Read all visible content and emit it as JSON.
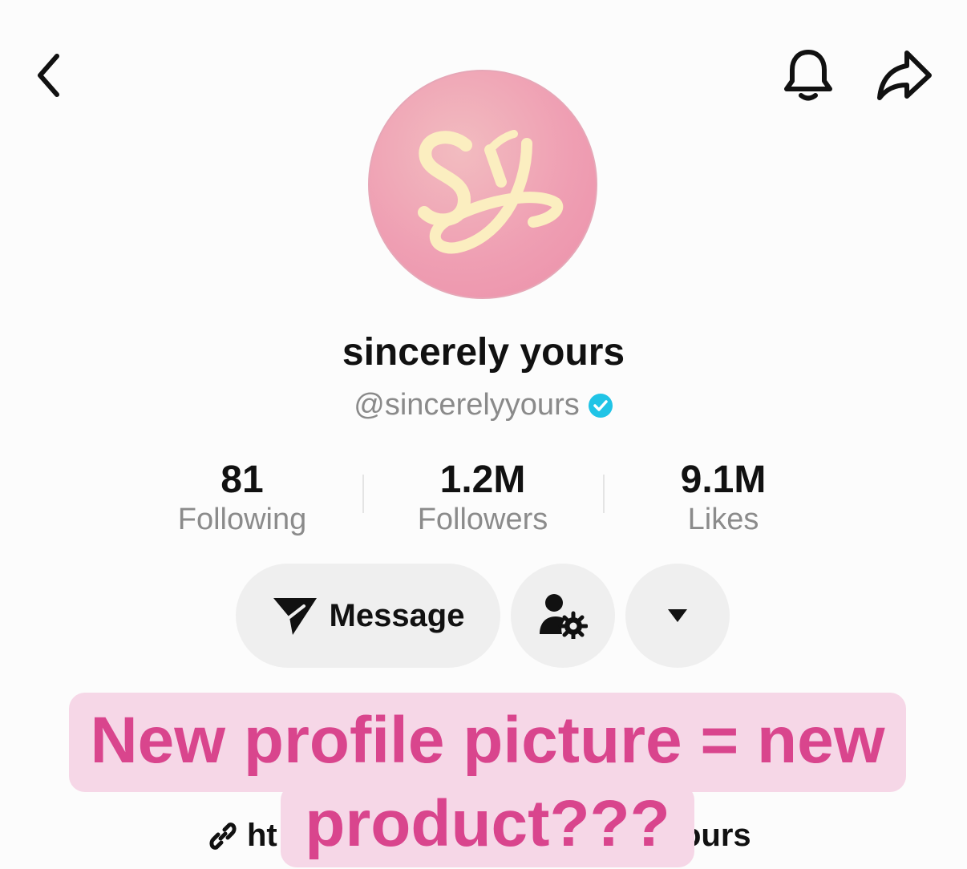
{
  "profile": {
    "display_name": "sincerely yours",
    "handle": "@sincerelyyours",
    "verified": true,
    "avatar_monogram": "SY",
    "avatar_colors": [
      "#f2bcc0",
      "#eb8fa9",
      "#fbeec0"
    ]
  },
  "header": {
    "back_icon": "chevron-left-icon",
    "bell_icon": "bell-icon",
    "share_icon": "share-arrow-icon"
  },
  "stats": [
    {
      "value": "81",
      "label": "Following"
    },
    {
      "value": "1.2M",
      "label": "Followers"
    },
    {
      "value": "9.1M",
      "label": "Likes"
    }
  ],
  "actions": {
    "message_label": "Message",
    "message_icon": "send-icon",
    "friend_settings_icon": "user-gear-icon",
    "more_icon": "caret-down-icon"
  },
  "bio": {
    "link_start": "ht",
    "link_end": "ours",
    "link_icon": "link-icon"
  },
  "overlay": {
    "caption_line1": "New profile picture = new",
    "caption_line2": "product???",
    "color": "#d9458d",
    "background": "#f6d7e7"
  },
  "colors": {
    "verified": "#20c4e6",
    "text": "#111111",
    "muted": "#8a8a8a",
    "pill": "#efefef"
  }
}
